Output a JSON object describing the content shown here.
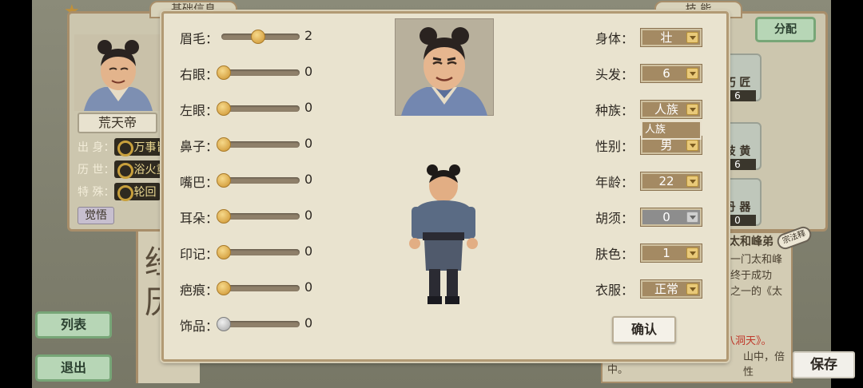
{
  "background": {
    "tab_basic_info": "基础信息",
    "tab_skills": "技  能",
    "assign_button": "分配",
    "assign_ghost": "分配",
    "character_name": "荒天帝",
    "origin_label": "出 身：",
    "origin_value": "万事皆",
    "history_label": "历 世：",
    "history_value": "浴火重",
    "special_label": "特 殊：",
    "special_value": "轮回",
    "awaken_button": "觉悟",
    "list_button": "列表",
    "exit_button": "退出",
    "skills": [
      {
        "label": "巧 匠",
        "value": "6"
      },
      {
        "label": "岐 黄",
        "value": "6"
      },
      {
        "label": "丹 器",
        "value": "0"
      }
    ],
    "partial_skill_labels": [
      "源",
      "纸",
      "法"
    ],
    "story_title": "太和峰弟",
    "story_badge": "宗法释",
    "story_lines": [
      "一门太和峰",
      "终于成功",
      "之一的《太"
    ],
    "story_footer": "中。",
    "story_highlight": "《四十八洞天》。",
    "story_line2": "山中，倍性"
  },
  "dialog": {
    "sliders": [
      {
        "label": "眉毛：",
        "value": "2",
        "fraction": 0.44,
        "style": "gold"
      },
      {
        "label": "右眼：",
        "value": "0",
        "fraction": 0.0,
        "style": "gold"
      },
      {
        "label": "左眼：",
        "value": "0",
        "fraction": 0.0,
        "style": "gold"
      },
      {
        "label": "鼻子：",
        "value": "0",
        "fraction": 0.0,
        "style": "gold"
      },
      {
        "label": "嘴巴：",
        "value": "0",
        "fraction": 0.0,
        "style": "gold"
      },
      {
        "label": "耳朵：",
        "value": "0",
        "fraction": 0.0,
        "style": "gold"
      },
      {
        "label": "印记：",
        "value": "0",
        "fraction": 0.0,
        "style": "gold"
      },
      {
        "label": "疤痕：",
        "value": "0",
        "fraction": 0.0,
        "style": "gold"
      },
      {
        "label": "饰品：",
        "value": "0",
        "fraction": 0.0,
        "style": "grey"
      }
    ],
    "selects": [
      {
        "label": "身体：",
        "value": "壮",
        "disabled": false
      },
      {
        "label": "头发：",
        "value": "6",
        "disabled": false
      },
      {
        "label": "种族：",
        "value": "人族",
        "disabled": false
      },
      {
        "label": "性别：",
        "value": "男",
        "disabled": false
      },
      {
        "label": "年龄：",
        "value": "22",
        "disabled": false
      },
      {
        "label": "胡须：",
        "value": "0",
        "disabled": true
      },
      {
        "label": "肤色：",
        "value": "1",
        "disabled": false
      },
      {
        "label": "衣服：",
        "value": "正常",
        "disabled": false
      }
    ],
    "race_dropdown_option": "人族",
    "confirm_button": "确认"
  },
  "save_button": "保存",
  "colors": {
    "dialog_bg": "#e9e3cf",
    "dialog_border": "#b29a74",
    "select_bg": "#a48a63",
    "knob_gold": "#d9a74a",
    "button_green": "#b7d6b6"
  }
}
